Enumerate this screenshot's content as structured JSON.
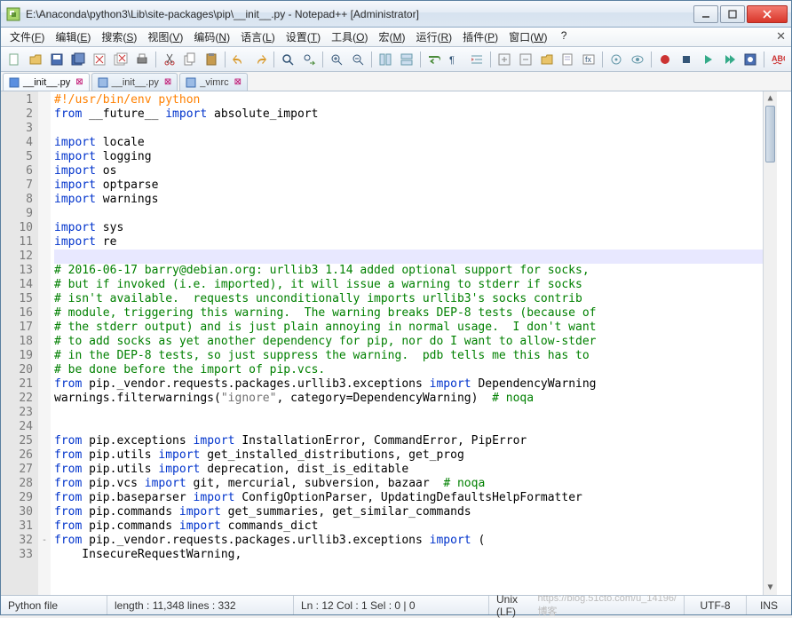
{
  "window": {
    "title": "E:\\Anaconda\\python3\\Lib\\site-packages\\pip\\__init__.py - Notepad++ [Administrator]"
  },
  "menu": {
    "items": [
      "文件(F)",
      "编辑(E)",
      "搜索(S)",
      "视图(V)",
      "编码(N)",
      "语言(L)",
      "设置(T)",
      "工具(O)",
      "宏(M)",
      "运行(R)",
      "插件(P)",
      "窗口(W)",
      "?"
    ]
  },
  "toolbar_icons": [
    "new-file-icon",
    "open-icon",
    "save-icon",
    "save-all-icon",
    "close-icon",
    "close-all-icon",
    "print-icon",
    "sep",
    "cut-icon",
    "copy-icon",
    "paste-icon",
    "sep",
    "undo-icon",
    "redo-icon",
    "sep",
    "find-icon",
    "replace-icon",
    "sep",
    "zoom-in-icon",
    "zoom-out-icon",
    "sep",
    "sync-v-icon",
    "sync-h-icon",
    "sep",
    "wrap-icon",
    "show-chars-icon",
    "indent-icon",
    "sep",
    "fold-icon",
    "unfold-icon",
    "folder-icon",
    "doc-map-icon",
    "func-list-icon",
    "sep",
    "show-all-chars-icon",
    "eye-icon",
    "sep",
    "record-icon",
    "stop-icon",
    "play-icon",
    "playx-icon",
    "save-macro-icon",
    "sep",
    "spell-icon"
  ],
  "tabs": [
    {
      "name": "__init__.py",
      "active": true,
      "dirty": true
    },
    {
      "name": "__init__.py",
      "active": false,
      "dirty": true
    },
    {
      "name": "_vimrc",
      "active": false,
      "dirty": true
    }
  ],
  "code_lines": [
    {
      "n": 1,
      "cls": "orng",
      "text": "#!/usr/bin/env python"
    },
    {
      "n": 2,
      "html": "<span class=\"kw\">from</span><span class=\"txt\"> __future__ </span><span class=\"kw\">import</span><span class=\"txt\"> absolute_import</span>"
    },
    {
      "n": 3,
      "text": ""
    },
    {
      "n": 4,
      "html": "<span class=\"kw\">import</span><span class=\"txt\"> locale</span>"
    },
    {
      "n": 5,
      "html": "<span class=\"kw\">import</span><span class=\"txt\"> logging</span>"
    },
    {
      "n": 6,
      "html": "<span class=\"kw\">import</span><span class=\"txt\"> os</span>"
    },
    {
      "n": 7,
      "html": "<span class=\"kw\">import</span><span class=\"txt\"> optparse</span>"
    },
    {
      "n": 8,
      "html": "<span class=\"kw\">import</span><span class=\"txt\"> warnings</span>"
    },
    {
      "n": 9,
      "text": ""
    },
    {
      "n": 10,
      "html": "<span class=\"kw\">import</span><span class=\"txt\"> sys</span>"
    },
    {
      "n": 11,
      "html": "<span class=\"kw\">import</span><span class=\"txt\"> re</span>"
    },
    {
      "n": 12,
      "text": "",
      "current": true
    },
    {
      "n": 13,
      "cls": "cm",
      "text": "# 2016-06-17 barry@debian.org: urllib3 1.14 added optional support for socks,"
    },
    {
      "n": 14,
      "cls": "cm",
      "text": "# but if invoked (i.e. imported), it will issue a warning to stderr if socks"
    },
    {
      "n": 15,
      "cls": "cm",
      "text": "# isn't available.  requests unconditionally imports urllib3's socks contrib"
    },
    {
      "n": 16,
      "cls": "cm",
      "text": "# module, triggering this warning.  The warning breaks DEP-8 tests (because of"
    },
    {
      "n": 17,
      "cls": "cm",
      "text": "# the stderr output) and is just plain annoying in normal usage.  I don't want"
    },
    {
      "n": 18,
      "cls": "cm",
      "text": "# to add socks as yet another dependency for pip, nor do I want to allow-stder"
    },
    {
      "n": 19,
      "cls": "cm",
      "text": "# in the DEP-8 tests, so just suppress the warning.  pdb tells me this has to"
    },
    {
      "n": 20,
      "cls": "cm",
      "text": "# be done before the import of pip.vcs."
    },
    {
      "n": 21,
      "html": "<span class=\"kw\">from</span><span class=\"txt\"> pip._vendor.requests.packages.urllib3.exceptions </span><span class=\"kw\">import</span><span class=\"txt\"> DependencyWarning</span>"
    },
    {
      "n": 22,
      "html": "<span class=\"txt\">warnings.filterwarnings(</span><span class=\"str\">\"ignore\"</span><span class=\"txt\">, category=DependencyWarning)  </span><span class=\"cm\"># noqa</span>"
    },
    {
      "n": 23,
      "text": ""
    },
    {
      "n": 24,
      "text": ""
    },
    {
      "n": 25,
      "html": "<span class=\"kw\">from</span><span class=\"txt\"> pip.exceptions </span><span class=\"kw\">import</span><span class=\"txt\"> InstallationError, CommandError, PipError</span>"
    },
    {
      "n": 26,
      "html": "<span class=\"kw\">from</span><span class=\"txt\"> pip.utils </span><span class=\"kw\">import</span><span class=\"txt\"> get_installed_distributions, get_prog</span>"
    },
    {
      "n": 27,
      "html": "<span class=\"kw\">from</span><span class=\"txt\"> pip.utils </span><span class=\"kw\">import</span><span class=\"txt\"> deprecation, dist_is_editable</span>"
    },
    {
      "n": 28,
      "html": "<span class=\"kw\">from</span><span class=\"txt\"> pip.vcs </span><span class=\"kw\">import</span><span class=\"txt\"> git, mercurial, subversion, bazaar  </span><span class=\"cm\"># noqa</span>"
    },
    {
      "n": 29,
      "html": "<span class=\"kw\">from</span><span class=\"txt\"> pip.baseparser </span><span class=\"kw\">import</span><span class=\"txt\"> ConfigOptionParser, UpdatingDefaultsHelpFormatter</span>"
    },
    {
      "n": 30,
      "html": "<span class=\"kw\">from</span><span class=\"txt\"> pip.commands </span><span class=\"kw\">import</span><span class=\"txt\"> get_summaries, get_similar_commands</span>"
    },
    {
      "n": 31,
      "html": "<span class=\"kw\">from</span><span class=\"txt\"> pip.commands </span><span class=\"kw\">import</span><span class=\"txt\"> commands_dict</span>"
    },
    {
      "n": 32,
      "html": "<span class=\"kw\">from</span><span class=\"txt\"> pip._vendor.requests.packages.urllib3.exceptions </span><span class=\"kw\">import</span><span class=\"txt\"> (</span>",
      "fold": "-"
    },
    {
      "n": 33,
      "html": "<span class=\"txt\">    InsecureRequestWarning,</span>"
    }
  ],
  "status": {
    "filetype": "Python file",
    "length_lines": "length : 11,348    lines : 332",
    "caret": "Ln : 12    Col : 1    Sel : 0 | 0",
    "eol": "Unix (LF)",
    "encoding": "UTF-8",
    "ins": "INS",
    "watermark": "https://blog.51cto.com/u_14196/博客"
  }
}
